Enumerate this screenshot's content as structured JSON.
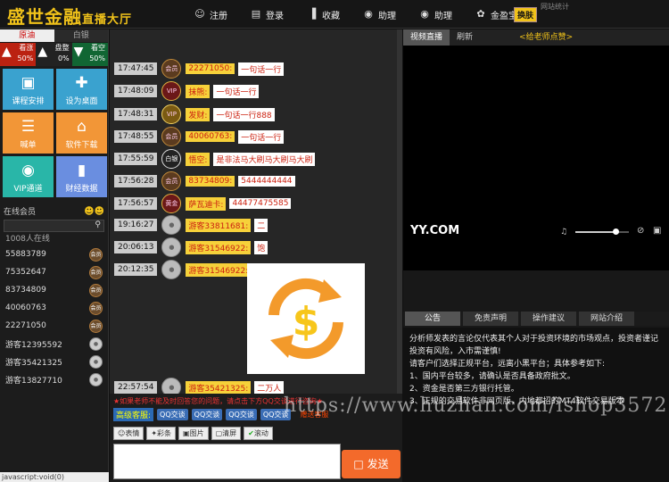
{
  "header": {
    "logo_main": "盛世金融",
    "logo_sub": "直播大厅",
    "nav": [
      {
        "label": "注册",
        "icon": "user-icon"
      },
      {
        "label": "登录",
        "icon": "login-icon"
      },
      {
        "label": "收藏",
        "icon": "chart-icon"
      },
      {
        "label": "助理",
        "icon": "qq-icon"
      },
      {
        "label": "助理",
        "icon": "qq-icon"
      },
      {
        "label": "金盈宝",
        "icon": "gold-icon"
      }
    ],
    "switch_label": "换肤",
    "site_stat": "网站统计"
  },
  "left": {
    "tabs": [
      "原油",
      "白银"
    ],
    "stats": [
      {
        "label": "看涨",
        "value": "50%"
      },
      {
        "label": "盘整",
        "value": "0%"
      },
      {
        "label": "看空",
        "value": "50%"
      }
    ],
    "tiles": [
      {
        "label": "课程安排",
        "icon": "monitor-icon"
      },
      {
        "label": "设为桌面",
        "icon": "desktop-icon"
      },
      {
        "label": "喊单",
        "icon": "list-icon"
      },
      {
        "label": "软件下载",
        "icon": "house-icon"
      },
      {
        "label": "VIP通道",
        "icon": "vip-icon"
      },
      {
        "label": "财经数据",
        "icon": "folder-icon"
      }
    ],
    "online_title": "在线会员",
    "online_count": "1008人在线",
    "members": [
      {
        "name": "55883789",
        "badge": "会员"
      },
      {
        "name": "75352647",
        "badge": "会员"
      },
      {
        "name": "83734809",
        "badge": "会员"
      },
      {
        "name": "40060763",
        "badge": "会员"
      },
      {
        "name": "22271050",
        "badge": "会员"
      },
      {
        "name": "游客12395592",
        "badge": ""
      },
      {
        "name": "游客35421325",
        "badge": ""
      },
      {
        "name": "游客13827710",
        "badge": ""
      }
    ],
    "statusbar": "javascript:void(0)"
  },
  "chat": {
    "messages": [
      {
        "time": "17:47:45",
        "badge": "会员",
        "user": "22271050:",
        "text": "一句话一行"
      },
      {
        "time": "17:48:09",
        "badge": "VIP",
        "user": "抹熊:",
        "text": "一句话一行"
      },
      {
        "time": "17:48:31",
        "badge": "VIP",
        "user": "发财:",
        "text": "一句话一行888"
      },
      {
        "time": "17:48:55",
        "badge": "会员",
        "user": "40060763:",
        "text": "一句话一行"
      },
      {
        "time": "17:55:59",
        "badge": "白银",
        "user": "悟空:",
        "text": "是非法马大刷马大刷马大刷"
      },
      {
        "time": "17:56:28",
        "badge": "会员",
        "user": "83734809:",
        "text": "5444444444"
      },
      {
        "time": "17:56:57",
        "badge": "黄金",
        "user": "萨瓦迪卡:",
        "text": "44477475585"
      },
      {
        "time": "19:16:27",
        "badge": "",
        "user": "游客33811681:",
        "text": "二"
      },
      {
        "time": "20:06:13",
        "badge": "",
        "user": "游客31546922:",
        "text": "饱"
      },
      {
        "time": "20:12:35",
        "badge": "",
        "user": "游客31546922:",
        "text": ""
      },
      {
        "time": "22:57:54",
        "badge": "",
        "user": "游客35421325:",
        "text": "二万人"
      }
    ],
    "notice": "★如果老师不能及时回答您的问题，请点击下方QQ交谈进行咨询★",
    "qq_label": "高级客服:",
    "qq_buttons": [
      "QQ交谈",
      "QQ交谈",
      "QQ交谈",
      "QQ交谈"
    ],
    "gift_text": "赠送客服",
    "tools": [
      "表情",
      "彩条",
      "图片",
      "清屏",
      "滚动"
    ],
    "send_label": "发送"
  },
  "right": {
    "video_tabs": [
      "视频直播",
      "刷新"
    ],
    "teacher_label": "<给老师点赞>",
    "yy_logo": "YY.COM",
    "volume": 0.75,
    "info_tabs": [
      "公告",
      "免责声明",
      "操作建议",
      "网站介绍"
    ],
    "info_lines": [
      "分析师发表的言论仅代表其个人对于投资环境的市场观点，投资者谨记投资有风险，入市需谨慎!",
      "请客户们选择正规平台，远离小黑平台；具体参考如下:",
      "1、国内平台较多，请确认是否具备政府批文。",
      "2、资金是否第三方银行托管。",
      "3、正规的交易软件非网页版，内地都招的MT4软件交易版本"
    ]
  },
  "watermark": "https://www.huzhan.com/ishop3572"
}
